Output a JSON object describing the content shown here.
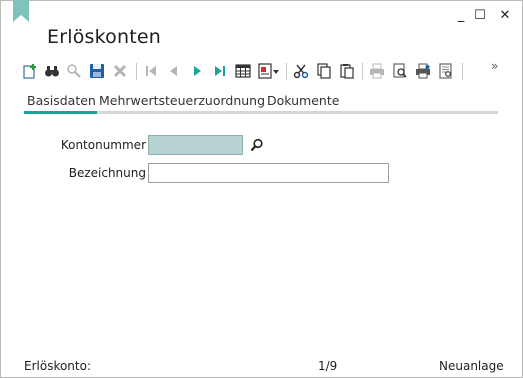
{
  "window": {
    "title": "Erlöskonten",
    "minimize_label": "_",
    "maximize_label": "☐",
    "close_label": "✕"
  },
  "toolbar": {
    "overflow_label": "»"
  },
  "tabs": [
    {
      "label": "Basisdaten"
    },
    {
      "label": "Mehrwertsteuerzuordnung"
    },
    {
      "label": "Dokumente"
    }
  ],
  "form": {
    "kontonummer_label": "Kontonummer",
    "kontonummer_value": "",
    "bezeichnung_label": "Bezeichnung",
    "bezeichnung_value": ""
  },
  "status": {
    "left": "Erlöskonto:",
    "page": "1/9",
    "mode": "Neuanlage"
  },
  "colors": {
    "accent": "#1aa39a",
    "titlebar": "#2c333b",
    "input_highlight": "#b8d3d1"
  }
}
